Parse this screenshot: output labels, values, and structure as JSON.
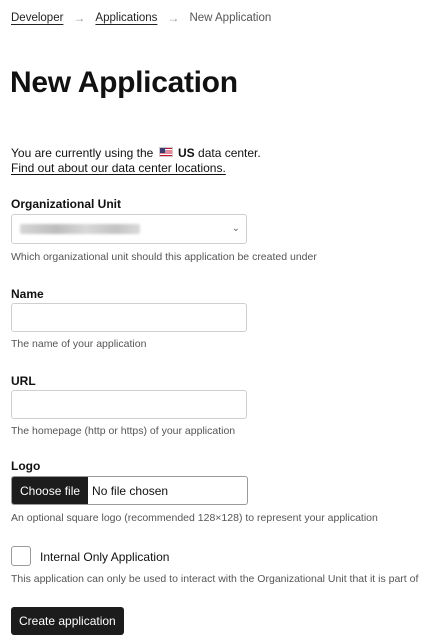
{
  "breadcrumb": {
    "items": [
      "Developer",
      "Applications"
    ],
    "separator": "→",
    "current": "New Application"
  },
  "title": "New Application",
  "datacenter": {
    "prefix": "You are currently using the",
    "flag_icon": "us-flag-icon",
    "region": "US",
    "suffix": "data center.",
    "link": "Find out about our data center locations."
  },
  "form": {
    "org_unit": {
      "label": "Organizational Unit",
      "help": "Which organizational unit should this application be created under"
    },
    "name": {
      "label": "Name",
      "value": "",
      "help": "The name of your application"
    },
    "url": {
      "label": "URL",
      "value": "",
      "help": "The homepage (http or https) of your application"
    },
    "logo": {
      "label": "Logo",
      "button": "Choose file",
      "status": "No file chosen",
      "help": "An optional square logo (recommended 128×128) to represent your application"
    },
    "internal": {
      "label": "Internal Only Application",
      "checked": false,
      "help": "This application can only be used to interact with the Organizational Unit that it is part of"
    },
    "submit": "Create application"
  }
}
